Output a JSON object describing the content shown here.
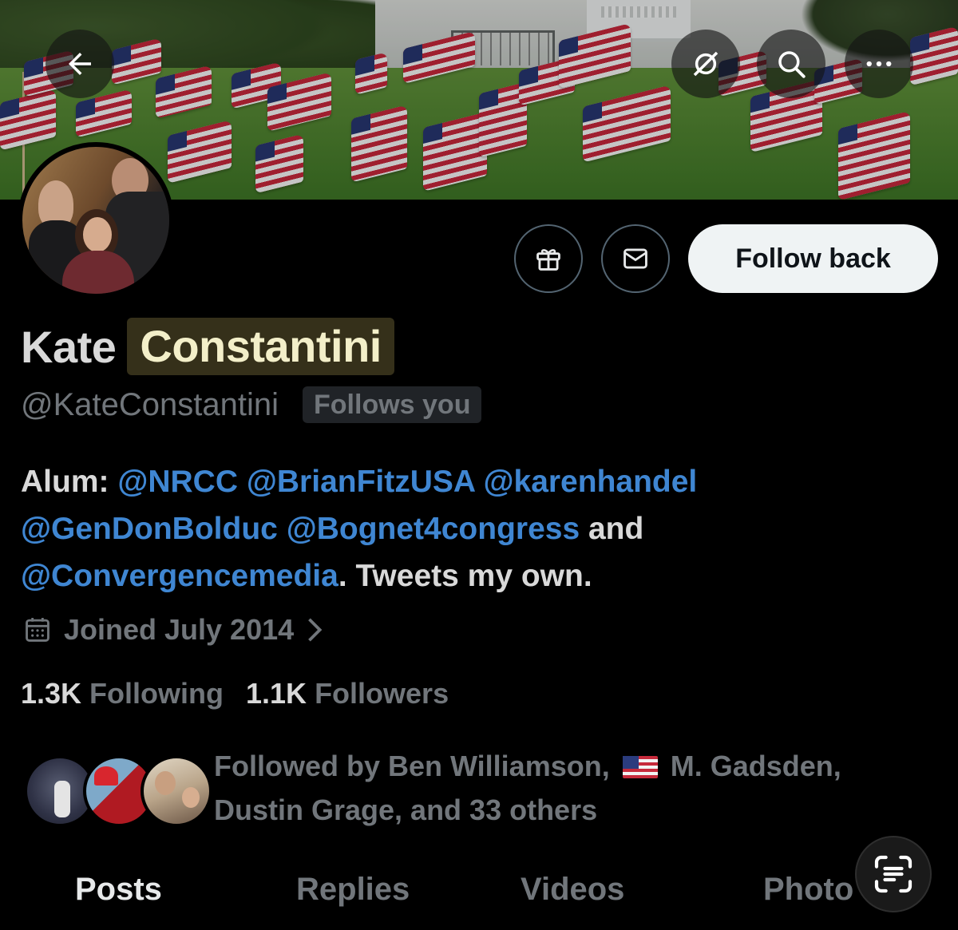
{
  "profile": {
    "name_first": "Kate",
    "name_last": "Constantini",
    "handle": "@KateConstantini",
    "follows_you": "Follows you",
    "follow_back_label": "Follow back"
  },
  "bio": {
    "prefix": "Alum: ",
    "mentions": [
      "@NRCC",
      "@BrianFitzUSA",
      "@karenhandel",
      "@GenDonBolduc",
      "@Bognet4congress",
      "@Convergencemedia"
    ],
    "and": " and ",
    "suffix": ". Tweets my own."
  },
  "joined": "Joined July 2014",
  "stats": {
    "following_count": "1.3K",
    "following_label": "Following",
    "followers_count": "1.1K",
    "followers_label": "Followers"
  },
  "followed_by": {
    "prefix": "Followed by Ben Williamson, ",
    "middle": " M. Gadsden,",
    "rest": "Dustin Grage, and 33 others"
  },
  "tabs": [
    "Posts",
    "Replies",
    "Videos",
    "Photo"
  ],
  "icons": {
    "back": "arrow-left-icon",
    "grok": "slashed-circle-icon",
    "search": "search-icon",
    "more": "more-dots-icon",
    "gift": "gift-icon",
    "message": "envelope-icon",
    "calendar": "calendar-icon",
    "scan": "text-scan-icon"
  },
  "colors": {
    "accent_link": "#3f86d2",
    "muted": "#71767b",
    "highlight_bg": "#35301a"
  }
}
